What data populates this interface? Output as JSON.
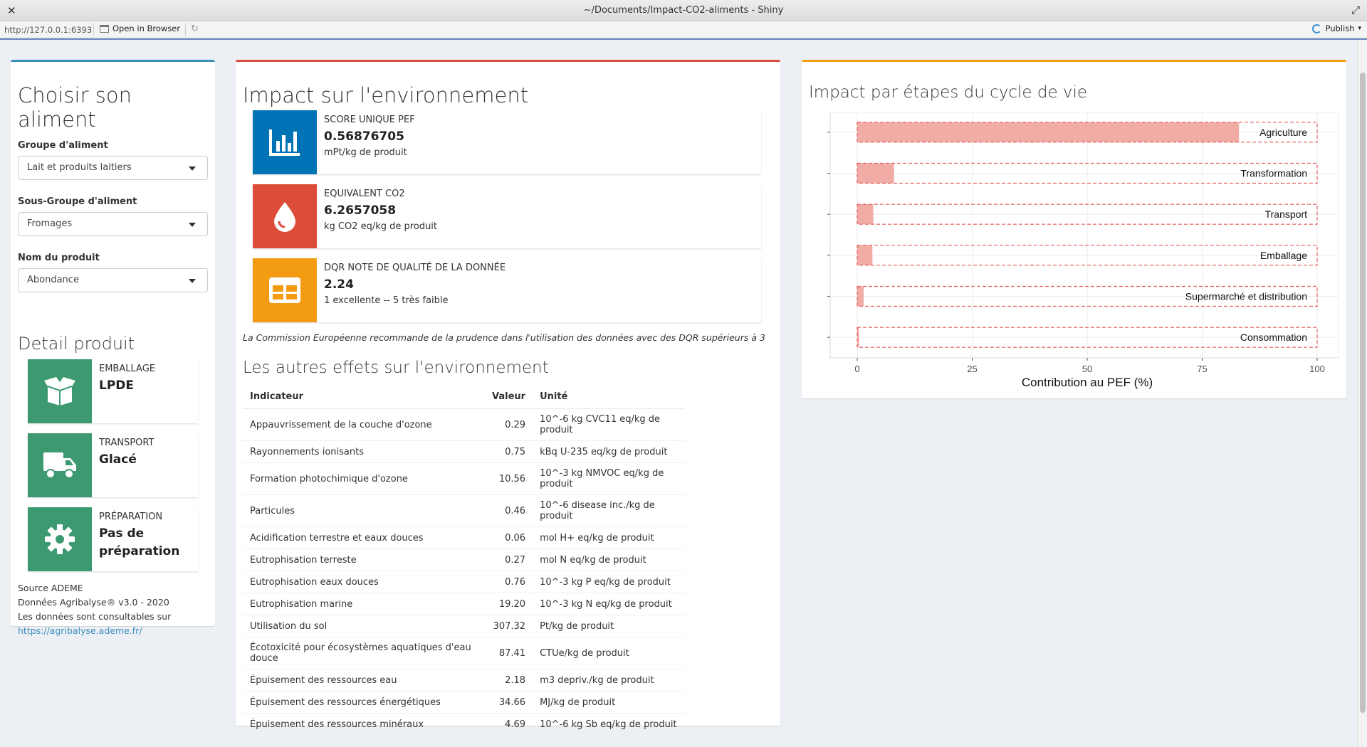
{
  "window": {
    "title": "~/Documents/Impact-CO2-aliments - Shiny",
    "url": "http://127.0.0.1:6393",
    "open_browser": "Open in Browser",
    "publish": "Publish"
  },
  "left": {
    "title": "Choisir son aliment",
    "fields": [
      {
        "label": "Groupe d'aliment",
        "value": "Lait et produits laitiers"
      },
      {
        "label": "Sous-Groupe d'aliment",
        "value": "Fromages"
      },
      {
        "label": "Nom du produit",
        "value": "Abondance"
      }
    ],
    "detail_title": "Detail produit",
    "details": [
      {
        "label": "EMBALLAGE",
        "value": "LPDE",
        "icon": "box-open-icon",
        "color": "#3d9970"
      },
      {
        "label": "TRANSPORT",
        "value": "Glacé",
        "icon": "truck-icon",
        "color": "#3d9970"
      },
      {
        "label": "PRÉPARATION",
        "value": "Pas de préparation",
        "icon": "gear-icon",
        "color": "#3d9970"
      }
    ],
    "source_lines": [
      "Source ADEME",
      "Données Agribalyse® v3.0 - 2020",
      "Les données sont consultables sur"
    ],
    "source_link": "https://agribalyse.ademe.fr/"
  },
  "middle": {
    "title": "Impact sur l'environnement",
    "kpis": [
      {
        "label": "SCORE UNIQUE PEF",
        "value": "0.56876705",
        "unit": "mPt/kg de produit",
        "icon": "bar-chart-icon",
        "color": "#0073b7"
      },
      {
        "label": "EQUIVALENT CO2",
        "value": "6.2657058",
        "unit": "kg CO2 eq/kg de produit",
        "icon": "drop-icon",
        "color": "#dd4b39"
      },
      {
        "label": "DQR NOTE DE QUALITÉ DE LA DONNÉE",
        "value": "2.24",
        "unit": "1 excellente -- 5 très faible",
        "icon": "table-icon",
        "color": "#f39c12"
      }
    ],
    "note": "La Commission Européenne recommande de la prudence dans l'utilisation des données avec des DQR supérieurs à 3",
    "other_title": "Les autres effets sur l'environnement",
    "table": {
      "headers": [
        "Indicateur",
        "Valeur",
        "Unité"
      ],
      "rows": [
        [
          "Appauvrissement de la couche d'ozone",
          "0.29",
          "10^-6 kg CVC11 eq/kg de produit"
        ],
        [
          "Rayonnements ionisants",
          "0.75",
          "kBq U-235 eq/kg de produit"
        ],
        [
          "Formation photochimique d'ozone",
          "10.56",
          "10^-3 kg NMVOC eq/kg de produit"
        ],
        [
          "Particules",
          "0.46",
          "10^-6 disease inc./kg de produit"
        ],
        [
          "Acidification terrestre et eaux douces",
          "0.06",
          "mol H+ eq/kg de produit"
        ],
        [
          "Eutrophisation terreste",
          "0.27",
          "mol N eq/kg de produit"
        ],
        [
          "Eutrophisation eaux douces",
          "0.76",
          "10^-3 kg P eq/kg de produit"
        ],
        [
          "Eutrophisation marine",
          "19.20",
          "10^-3 kg N eq/kg de produit"
        ],
        [
          "Utilisation du sol",
          "307.32",
          "Pt/kg de produit"
        ],
        [
          "Écotoxicité pour écosystèmes aquatiques d'eau douce",
          "87.41",
          "CTUe/kg de produit"
        ],
        [
          "Épuisement des ressources eau",
          "2.18",
          "m3 depriv./kg de produit"
        ],
        [
          "Épuisement des ressources énergétiques",
          "34.66",
          "MJ/kg de produit"
        ],
        [
          "Épuisement des ressources minéraux",
          "4.69",
          "10^-6 kg Sb eq/kg de produit"
        ]
      ]
    }
  },
  "right": {
    "title": "Impact par étapes du cycle de vie"
  },
  "chart_data": {
    "type": "bar",
    "orientation": "horizontal",
    "categories": [
      "Agriculture",
      "Transformation",
      "Transport",
      "Emballage",
      "Supermarché et distribution",
      "Consommation"
    ],
    "values": [
      83,
      8,
      3.5,
      3.3,
      1.4,
      0.4
    ],
    "xlabel": "Contribution au PEF (%)",
    "xlim": [
      0,
      100
    ],
    "xticks": [
      0,
      25,
      50,
      75,
      100
    ],
    "bar_color": "#f0a39b",
    "outline_color": "#e35b5b",
    "grid": true
  }
}
